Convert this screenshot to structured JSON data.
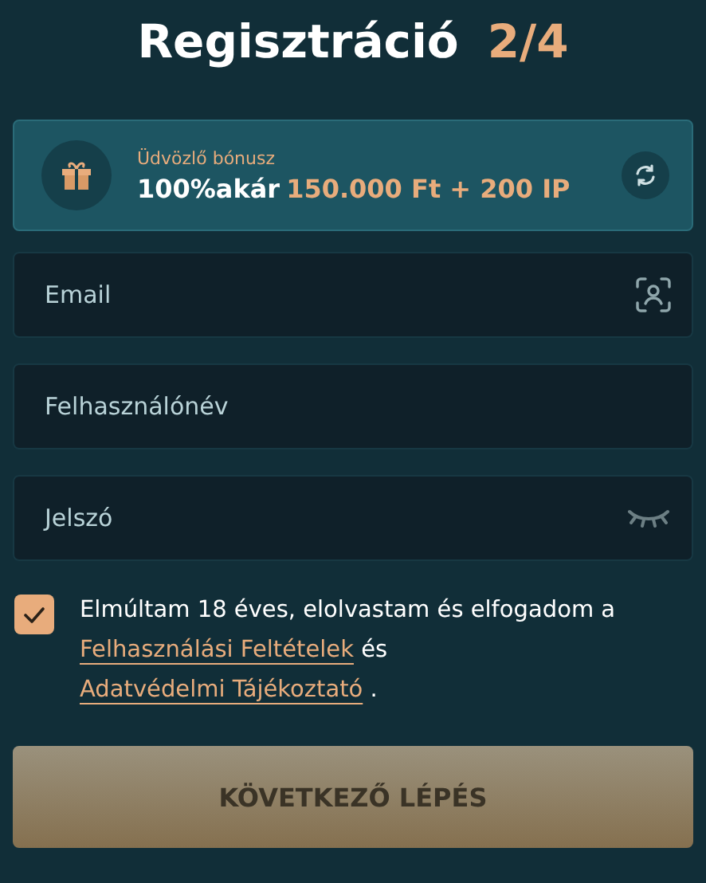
{
  "title": {
    "text": "Regisztráció",
    "step": "2/4"
  },
  "bonus": {
    "label": "Üdvözlő bónusz",
    "lead": "100%akár",
    "amount": "150.000 Ft + 200 IP"
  },
  "fields": [
    {
      "placeholder": "Email",
      "kind": "email"
    },
    {
      "placeholder": "Felhasználónév",
      "kind": "text"
    },
    {
      "placeholder": "Jelszó",
      "kind": "password"
    }
  ],
  "consent": {
    "checked": true,
    "parts": [
      {
        "kind": "text",
        "text": "Elmúltam 18 éves, elolvastam és elfogadom a"
      },
      {
        "kind": "link",
        "text": "Felhasználási Feltételek"
      },
      {
        "kind": "text",
        "text": "és"
      },
      {
        "kind": "link",
        "text": "Adatvédelmi Tájékoztató"
      },
      {
        "kind": "text",
        "text": "."
      }
    ]
  },
  "submit": {
    "label": "KÖVETKEZŐ LÉPÉS",
    "disabled": true
  }
}
